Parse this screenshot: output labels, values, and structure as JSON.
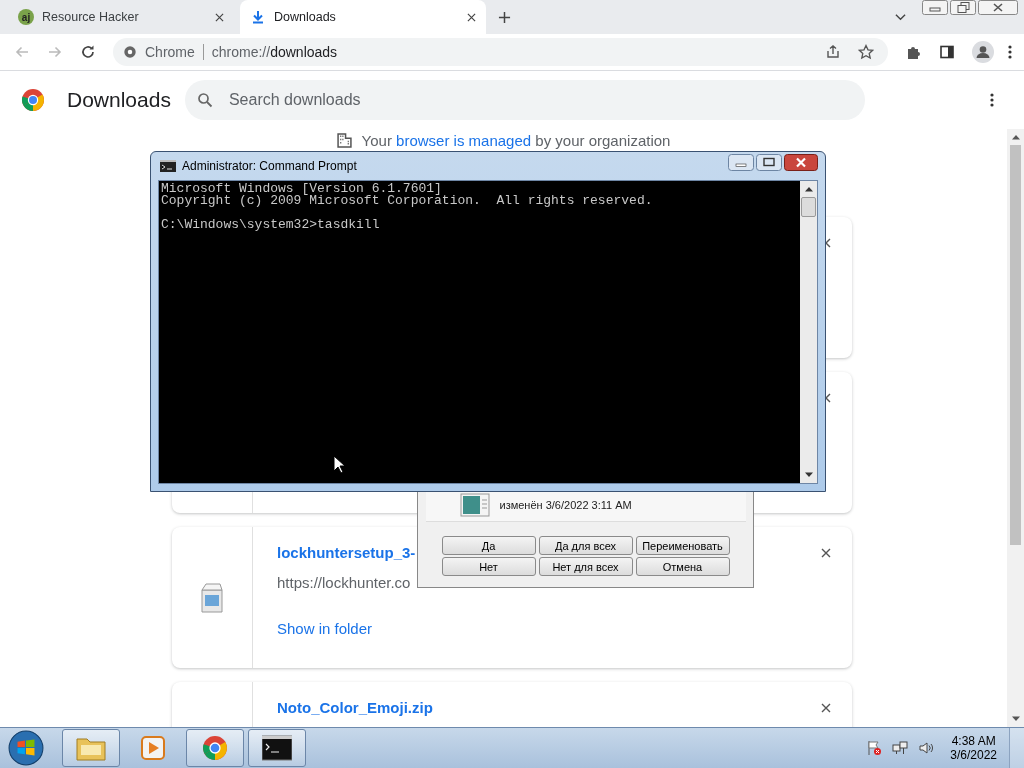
{
  "browser": {
    "tabs": [
      {
        "title": "Resource Hacker",
        "favicon_text": "aj",
        "kind": "app",
        "selected": false
      },
      {
        "title": "Downloads",
        "kind": "downloads",
        "selected": true
      }
    ],
    "omnibox": {
      "site_label": "Chrome",
      "url_scheme": "chrome://",
      "url_path": "downloads"
    }
  },
  "page": {
    "title": "Downloads",
    "search": {
      "placeholder": "Search downloads"
    },
    "managed_notice": {
      "before": "Your ",
      "link": "browser is managed",
      "after": " by your organization"
    },
    "items": [
      {
        "kind": "covered"
      },
      {
        "kind": "covered"
      },
      {
        "kind": "file",
        "name": "lockhuntersetup_3-",
        "url": "https://lockhunter.co",
        "action": "Show in folder"
      },
      {
        "kind": "file",
        "name": "Noto_Color_Emoji.zip"
      }
    ]
  },
  "dialog": {
    "modified": "изменён 3/6/2022 3:11 AM",
    "buttons": [
      "Да",
      "Да для всех",
      "Переименовать",
      "Нет",
      "Нет для всех",
      "Отмена"
    ]
  },
  "console": {
    "title": "Administrator: Command Prompt",
    "output": "Microsoft Windows [Version 6.1.7601]\nCopyright (c) 2009 Microsoft Corporation.  All rights reserved.\n\nC:\\Windows\\system32>tasdkill"
  },
  "taskbar": {
    "apps": [
      {
        "kind": "explorer",
        "running": true
      },
      {
        "kind": "media",
        "running": false
      },
      {
        "kind": "chrome",
        "running": true
      },
      {
        "kind": "console",
        "running": true
      }
    ],
    "clock": {
      "time": "4:38 AM",
      "date": "3/6/2022"
    }
  }
}
